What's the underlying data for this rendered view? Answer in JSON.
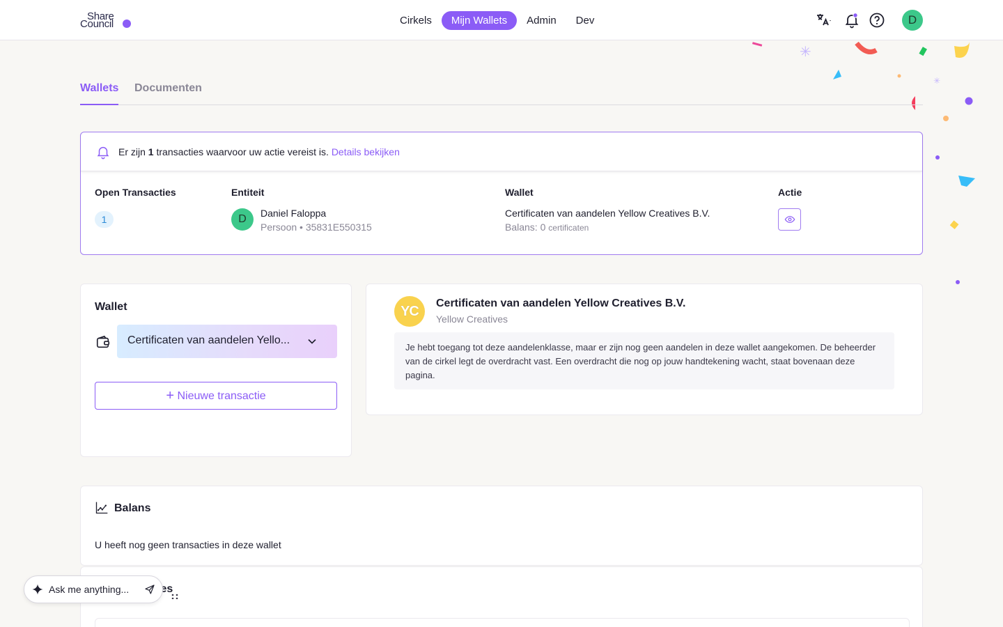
{
  "header": {
    "logo_line1": "Share",
    "logo_line2": "Council",
    "nav": [
      "Cirkels",
      "Mijn Wallets",
      "Admin",
      "Dev"
    ],
    "active_nav": "Mijn Wallets",
    "user_initial": "D",
    "icons": [
      "translate-icon",
      "bell-icon",
      "help-icon"
    ],
    "accent_color": "#8b5cf6"
  },
  "tabs": [
    "Wallets",
    "Documenten"
  ],
  "pending": {
    "msg_before": "Er zijn ",
    "count": "1",
    "msg_after": " transacties waarvoor uw actie vereist is. ",
    "link": "Details bekijken",
    "columns": [
      "Open Transacties",
      "Entiteit",
      "Wallet",
      "Actie"
    ],
    "row": {
      "open_count": "1",
      "entity_initial": "D",
      "entity_name": "Daniel Faloppa",
      "entity_sub": "Persoon • 35831E550315",
      "wallet_name": "Certificaten van aandelen Yellow Creatives B.V.",
      "balance_label": "Balans: 0",
      "balance_unit": "certificaten"
    }
  },
  "wallet_card": {
    "title": "Wallet",
    "selected": "Certificaten van aandelen Yello...",
    "new_tx": "Nieuwe transactie"
  },
  "info_card": {
    "initials": "YC",
    "title": "Certificaten van aandelen Yellow Creatives B.V.",
    "subtitle": "Yellow Creatives",
    "note": "Je hebt toegang tot deze aandelenklasse, maar er zijn nog geen aandelen in deze wallet aangekomen. De beheerder van de cirkel legt de overdracht vast. Een overdracht die nog op jouw handtekening wacht, staat bovenaan deze pagina."
  },
  "balans": {
    "title": "Balans",
    "empty": "U heeft nog geen transacties in deze wallet"
  },
  "next_section": {
    "title_fragment": "ies"
  },
  "ask": {
    "placeholder": "Ask me anything..."
  }
}
